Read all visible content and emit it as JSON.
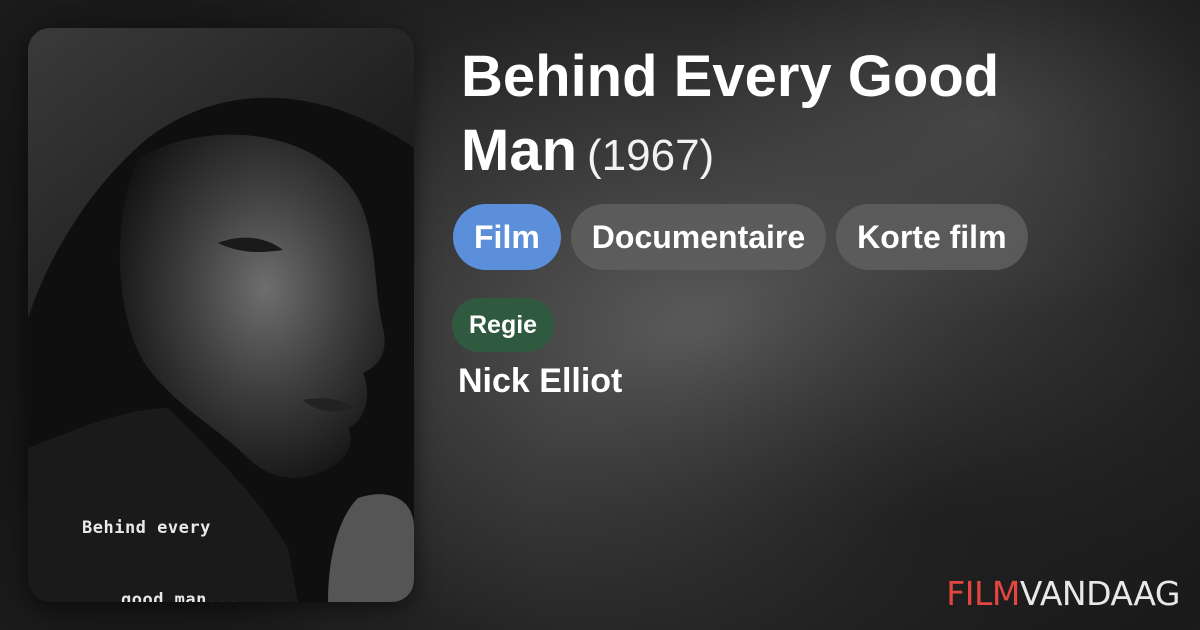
{
  "movie": {
    "title": "Behind Every Good Man",
    "year": "(1967)",
    "poster_caption_line1": "Behind every",
    "poster_caption_line2": "good man...",
    "genres": [
      "Film",
      "Documentaire",
      "Korte film"
    ],
    "active_genre_index": 0
  },
  "credits": {
    "role_label": "Regie",
    "director": "Nick Elliot"
  },
  "brand": {
    "logo_part1": "FILM",
    "logo_part2": "VANDAAG"
  },
  "colors": {
    "active_chip": "#5b8fd9",
    "chip": "#5f5f5f",
    "regie_badge": "#2f5a3f",
    "logo_red": "#e3463f"
  }
}
